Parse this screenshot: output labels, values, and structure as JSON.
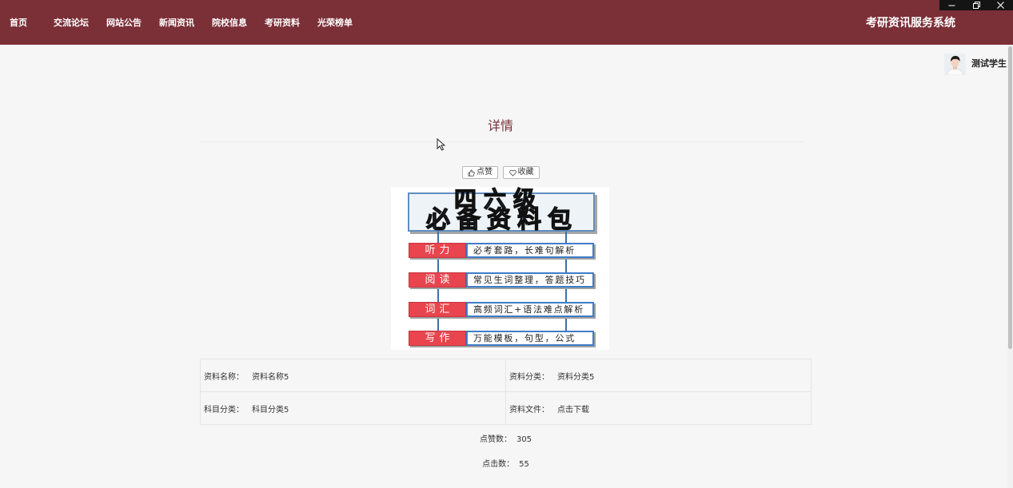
{
  "window_controls": {
    "minimize_icon": "minimize-icon",
    "restore_icon": "restore-icon",
    "close_icon": "close-icon"
  },
  "nav": {
    "items": [
      {
        "label": "首页"
      },
      {
        "label": "交流论坛"
      },
      {
        "label": "网站公告"
      },
      {
        "label": "新闻资讯"
      },
      {
        "label": "院校信息"
      },
      {
        "label": "考研资料"
      },
      {
        "label": "光荣榜单"
      }
    ]
  },
  "header": {
    "site_title": "考研资讯服务系统"
  },
  "user": {
    "name": "测试学生",
    "avatar_icon": "user-avatar"
  },
  "detail": {
    "title": "详情",
    "actions": {
      "like_label": "点赞",
      "like_icon": "thumbs-up-icon",
      "favorite_label": "收藏",
      "favorite_icon": "heart-icon"
    },
    "poster": {
      "headline": "四六级",
      "subheadline": "必备资料包",
      "rows": [
        {
          "tag": "听力",
          "text": "必考套路，长难句解析"
        },
        {
          "tag": "阅读",
          "text": "常见生词整理，答题技巧"
        },
        {
          "tag": "词汇",
          "text": "高频词汇+语法难点解析"
        },
        {
          "tag": "写作",
          "text": "万能模板，句型，公式"
        }
      ]
    },
    "info": {
      "rows": [
        [
          {
            "label": "资料名称：",
            "value": "资料名称5"
          },
          {
            "label": "资料分类：",
            "value": "资料分类5"
          }
        ],
        [
          {
            "label": "科目分类：",
            "value": "科目分类5"
          },
          {
            "label": "资料文件：",
            "value": "点击下载"
          }
        ]
      ]
    },
    "stats": {
      "likes_label": "点赞数：",
      "likes": "305",
      "clicks_label": "点击数：",
      "clicks": "55"
    }
  },
  "colors": {
    "header_bg": "#7b2f37",
    "page_bg": "#f6f6f6",
    "title_color": "#7b2f37",
    "poster_red": "#e8454f",
    "poster_blue": "#2d71d8"
  }
}
